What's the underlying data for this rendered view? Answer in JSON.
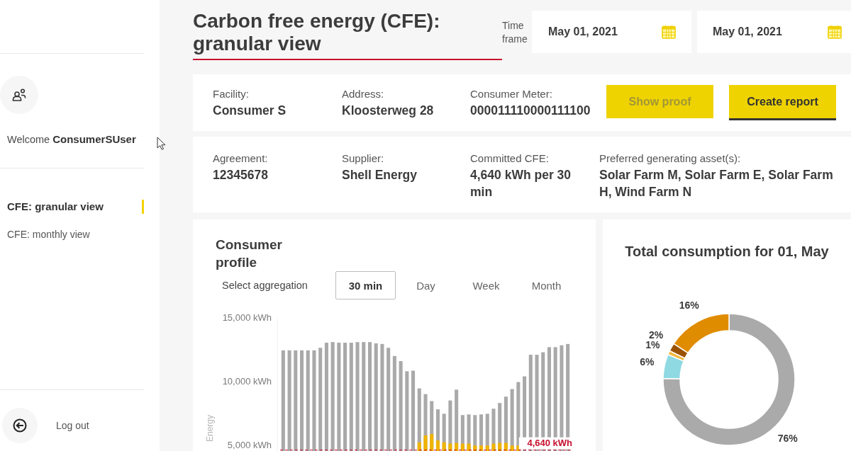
{
  "sidebar": {
    "welcome": "Welcome **ConsumerSUser**",
    "nav": [
      {
        "label": "CFE: granular view",
        "selected": true
      },
      {
        "label": "CFE: monthly view",
        "selected": false
      }
    ],
    "logout": "Log out"
  },
  "header": {
    "title": "Carbon free energy (CFE): granular view",
    "time_frame_label": "Time frame",
    "date_fields": [
      {
        "value": "May 01, 2021"
      },
      {
        "value": "May 01, 2021"
      }
    ]
  },
  "facility_card": {
    "fields": [
      {
        "label": "Facility:",
        "value": "Consumer S"
      },
      {
        "label": "Address:",
        "value": "Kloosterweg 28"
      },
      {
        "label": "Consumer Meter:",
        "value": "000011110000111100"
      }
    ],
    "buttons": [
      {
        "label": "Show proof",
        "disabled": true
      },
      {
        "label": "Create report",
        "disabled": false
      }
    ]
  },
  "agreement_card": {
    "fields": [
      {
        "label": "Agreement:",
        "value": "12345678"
      },
      {
        "label": "Supplier:",
        "value": "Shell Energy"
      },
      {
        "label": "Committed CFE:",
        "value": "4,640 kWh per 30 min"
      },
      {
        "label": "Preferred generating asset(s):",
        "value": "Solar Farm M, Solar Farm E, Solar Farm H, Wind Farm N"
      }
    ]
  },
  "consumer_profile": {
    "title": "Consumer profile",
    "aggregation_label": "Select aggregation",
    "aggregations": [
      {
        "label": "30 min",
        "selected": true
      },
      {
        "label": "Day",
        "selected": false
      },
      {
        "label": "Week",
        "selected": false
      },
      {
        "label": "Month",
        "selected": false
      }
    ],
    "chart_data": [
      {
        "type": "bar",
        "ylabel": "Energy",
        "categories": [
          null,
          null,
          null,
          null,
          null,
          null,
          null,
          null,
          null,
          null,
          null,
          null,
          null,
          null,
          null,
          null,
          null,
          null,
          null,
          null,
          null,
          null,
          null,
          null,
          null,
          null,
          null,
          null,
          null,
          null,
          null,
          null,
          null,
          null,
          null,
          null,
          null,
          null,
          null,
          null,
          null,
          null,
          null,
          null,
          null,
          null,
          null
        ],
        "series": [
          {
            "color": "#a9a9a9",
            "values": [
              12500,
              12500,
              12500,
              12500,
              12500,
              12500,
              12700,
              13100,
              13150,
              13100,
              13100,
              13100,
              13150,
              13150,
              13150,
              13050,
              13000,
              12700,
              12050,
              11650,
              10850,
              10900,
              9500,
              9050,
              8500,
              7850,
              7500,
              8550,
              9400,
              7400,
              7450,
              7400,
              7450,
              7500,
              7900,
              8350,
              8850,
              9450,
              10000,
              10450,
              12150,
              12150,
              12350,
              12750,
              12750,
              12900,
              13000
            ]
          },
          {
            "color": "#f0b400",
            "values": [
              null,
              null,
              null,
              null,
              null,
              null,
              null,
              null,
              null,
              null,
              null,
              null,
              null,
              null,
              null,
              null,
              null,
              null,
              null,
              null,
              null,
              null,
              5250,
              5800,
              5900,
              5400,
              5250,
              5150,
              5200,
              5150,
              5150,
              5000,
              5000,
              5000,
              5150,
              5200,
              5200,
              5000,
              5000,
              null,
              null,
              null,
              null,
              null,
              null,
              null,
              null
            ]
          }
        ],
        "ylim": [
          4400,
          15000
        ],
        "yticks": [
          {
            "value": 5000,
            "label": "5,000 kWh"
          },
          {
            "value": 10000,
            "label": "10,000 kWh"
          },
          {
            "value": 15000,
            "label": "15,000 kWh"
          }
        ],
        "ref_lines": [
          {
            "axis": "y",
            "value": 4640,
            "label": "4,640 kWh",
            "color": "#c8102e"
          }
        ]
      }
    ]
  },
  "total_consumption": {
    "chart_data": [
      {
        "type": "donut",
        "title": "Total consumption for 01, May",
        "categories": [
          null,
          null,
          null,
          null,
          null
        ],
        "values": [
          76,
          6,
          1,
          2,
          16
        ],
        "colors": [
          "#aaaaaa",
          "#8fd9e2",
          "#f4b840",
          "#9a5200",
          "#e08c00"
        ],
        "value_labels": [
          "76%",
          "6%",
          "1%",
          "2%",
          "16%"
        ]
      }
    ]
  }
}
